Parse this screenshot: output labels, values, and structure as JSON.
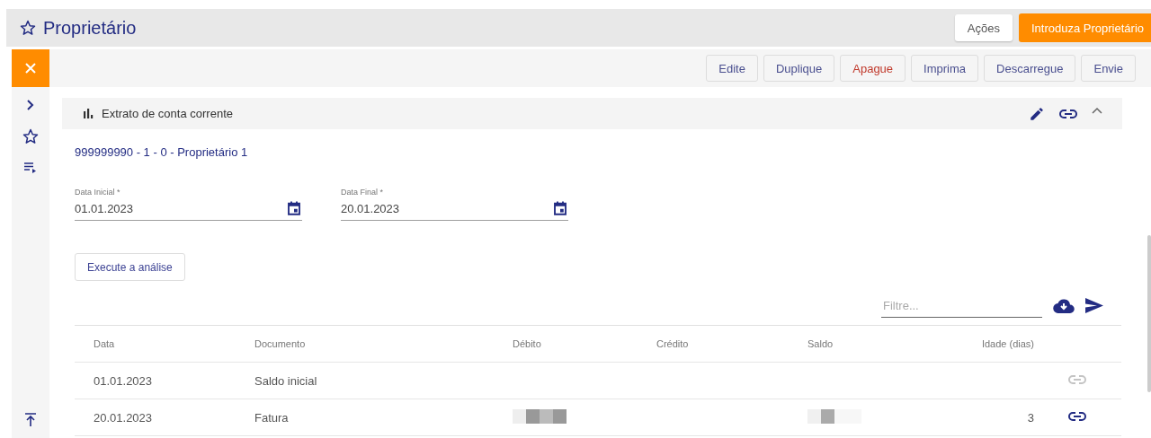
{
  "header": {
    "title": "Proprietário",
    "favorite": false,
    "actions_button": "Ações",
    "primary_button": "Introduza Proprietário"
  },
  "toolbar": [
    {
      "label": "Edite",
      "kind": "normal"
    },
    {
      "label": "Duplique",
      "kind": "normal"
    },
    {
      "label": "Apague",
      "kind": "danger"
    },
    {
      "label": "Imprima",
      "kind": "normal"
    },
    {
      "label": "Descarregue",
      "kind": "normal"
    },
    {
      "label": "Envie",
      "kind": "normal"
    }
  ],
  "panel": {
    "title": "Extrato de conta corrente",
    "expanded": true,
    "account": "999999990 - 1 - 0 - Proprietário 1",
    "fields": [
      {
        "label": "Data Inicial *",
        "value": "01.01.2023"
      },
      {
        "label": "Data Final *",
        "value": "20.01.2023"
      }
    ],
    "run_button": "Execute a análise",
    "filter": {
      "placeholder": "Filtre..."
    },
    "table": {
      "columns": [
        "Data",
        "Documento",
        "Débito",
        "Crédito",
        "Saldo",
        "Idade (dias)"
      ],
      "rows": [
        {
          "data": "01.01.2023",
          "documento": "Saldo inicial",
          "debito_redacted": false,
          "saldo_redacted": false,
          "idade": "",
          "link_enabled": false
        },
        {
          "data": "20.01.2023",
          "documento": "Fatura",
          "debito_redacted": true,
          "saldo_redacted": true,
          "idade": "3",
          "link_enabled": true
        }
      ]
    }
  }
}
